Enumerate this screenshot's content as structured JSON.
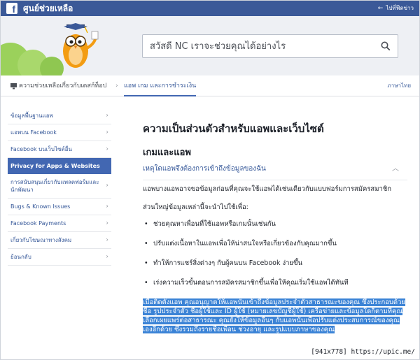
{
  "window": {
    "title": "ศูนย์ช่วยเหลือ",
    "right_link": "ไปที่ฟีดข่าว"
  },
  "search": {
    "placeholder": "สวัสดี NC เราจะช่วยคุณได้อย่างไร"
  },
  "breadcrumb": {
    "home": "ความช่วยเหลือเกี่ยวกับเดสก์ท็อป",
    "separator": "›",
    "current": "แอพ เกม และการชำระเงิน",
    "language": "ภาษาไทย"
  },
  "sidebar": {
    "items": [
      {
        "label": "ข้อมูลพื้นฐานแอพ"
      },
      {
        "label": "แอพบน Facebook"
      },
      {
        "label": "Facebook บนเว็บไซต์อื่น"
      },
      {
        "label": "Privacy for Apps & Websites"
      },
      {
        "label": "การสนับสนุนเกี่ยวกับแพลตฟอร์มและนักพัฒนา"
      },
      {
        "label": "Bugs & Known Issues"
      },
      {
        "label": "Facebook Payments"
      },
      {
        "label": "เกี่ยวกับโฆษณาทางสังคม"
      },
      {
        "label": "ย้อนกลับ"
      }
    ],
    "active_index": 3
  },
  "main": {
    "title": "ความเป็นส่วนตัวสำหรับแอพและเว็บไซต์",
    "section": "เกมและแอพ",
    "question": "เหตุใดแอพจึงต้องการเข้าถึงข้อมูลของฉัน",
    "para1": "แอพบางแอพอาจขอข้อมูลก่อนที่คุณจะใช้แอพได้เช่นเดียวกับแบบฟอร์มการสมัครสมาชิก",
    "para2": "ส่วนใหญ่ข้อมูลเหล่านี้จะนำไปใช้เพื่อ:",
    "bullets": [
      "ช่วยคุณหาเพื่อนที่ใช้แอพหรือเกมนั้นเช่นกัน",
      "ปรับแต่งเนื้อหาในแอพเพื่อให้น่าสนใจหรือเกี่ยวข้องกับคุณมากขึ้น",
      "ทำให้การแชร์สิ่งต่างๆ กับผู้คนบน Facebook ง่ายขึ้น",
      "เร่งความเร็วขั้นตอนการสมัครสมาชิกขึ้นเพื่อให้คุณเริ่มใช้แอพได้ทันที"
    ],
    "selected_text": "เมื่อติดตั้งแอพ คุณอนุญาตให้แอพนั้นเข้าถึงข้อมูลประจำตัวสาธารณะของคุณ ซึ่งประกอบด้วยชื่อ รูปประจำตัว ชื่อผู้ใช้และ ID ผู้ใช้ (หมายเลขบัญชีผู้ใช้) เครือข่ายและข้อมูลใดก็ตามที่คุณเลือกเผยแพร่ต่อสาธารณะ คุณยังให้ข้อมูลอื่นๆ กับแอพนั้นเพื่อปรับแต่งประสบการณ์ของคุณเองอีกด้วย ซึ่งรวมถึงรายชื่อเพื่อน ช่วงอายุ และรูปแบบภาษาของคุณ"
  },
  "watermark": "[941x778] https://upic.me/",
  "colors": {
    "brand": "#3b5998",
    "link": "#365899",
    "active": "#4267b2",
    "selection": "#3b83d6",
    "hero_bg": "#eef0f4"
  }
}
